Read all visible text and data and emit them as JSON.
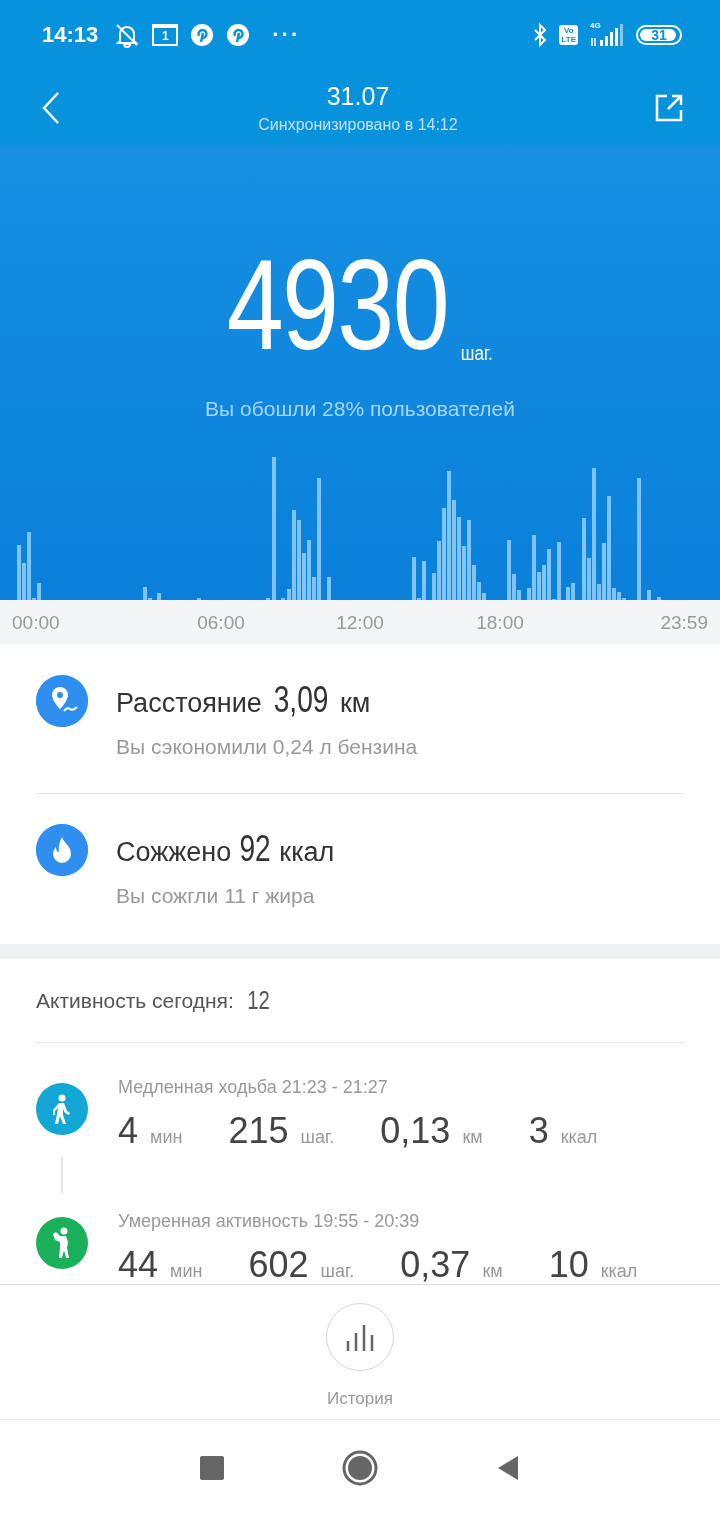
{
  "status_bar": {
    "time": "14:13",
    "calendar_day": "1",
    "more": "···",
    "volte_top": "Vo",
    "volte_bottom": "LTE",
    "network": "4G",
    "battery": "31"
  },
  "header": {
    "title": "31.07",
    "subtitle": "Синхронизировано в 14:12"
  },
  "steps": {
    "value": "4930",
    "unit": "шаг.",
    "comparison": "Вы обошли 28% пользователей"
  },
  "chart": {
    "axis_labels": [
      "00:00",
      "06:00",
      "12:00",
      "18:00",
      "23:59"
    ]
  },
  "summary": [
    {
      "kind": "distance",
      "label": "Расстояние",
      "value": "3,09",
      "unit": "км",
      "note": "Вы сэкономили 0,24 л бензина"
    },
    {
      "kind": "calories",
      "label": "Сожжено",
      "value": "92",
      "unit": "ккал",
      "note": "Вы сожгли 11 г жира"
    }
  ],
  "activity": {
    "label": "Активность сегодня:",
    "count": "12",
    "items": [
      {
        "kind": "walk",
        "color": "#12a7d4",
        "title": "Медленная ходьба 21:23 - 21:27",
        "stats": [
          {
            "value": "4",
            "unit": "мин"
          },
          {
            "value": "215",
            "unit": "шаг."
          },
          {
            "value": "0,13",
            "unit": "км"
          },
          {
            "value": "3",
            "unit": "ккал"
          }
        ]
      },
      {
        "kind": "moderate",
        "color": "#1bb05a",
        "title": "Умеренная активность 19:55 - 20:39",
        "stats": [
          {
            "value": "44",
            "unit": "мин"
          },
          {
            "value": "602",
            "unit": "шаг."
          },
          {
            "value": "0,37",
            "unit": "км"
          },
          {
            "value": "10",
            "unit": "ккал"
          }
        ]
      }
    ]
  },
  "history": {
    "label": "История"
  }
}
